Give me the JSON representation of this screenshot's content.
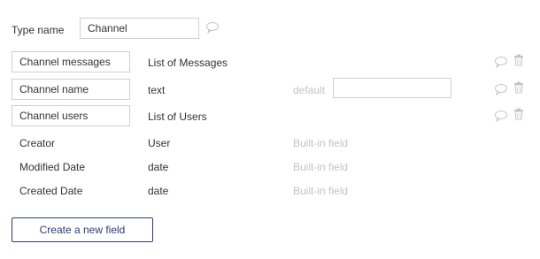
{
  "type_name": {
    "label": "Type name",
    "value": "Channel"
  },
  "fields": [
    {
      "name": "Channel messages",
      "type": "List of Messages"
    },
    {
      "name": "Channel name",
      "type": "text",
      "default_label": "default",
      "default_value": ""
    },
    {
      "name": "Channel users",
      "type": "List of Users"
    }
  ],
  "builtins": [
    {
      "name": "Creator",
      "type": "User",
      "note": "Built-in field"
    },
    {
      "name": "Modified Date",
      "type": "date",
      "note": "Built-in field"
    },
    {
      "name": "Created Date",
      "type": "date",
      "note": "Built-in field"
    }
  ],
  "create_button": "Create a new field",
  "icons": {
    "comment": "comment-icon",
    "delete": "trash-icon"
  },
  "colors": {
    "accent": "#2c3a7c",
    "muted": "#c4c4c4",
    "border": "#cfcfcf"
  }
}
